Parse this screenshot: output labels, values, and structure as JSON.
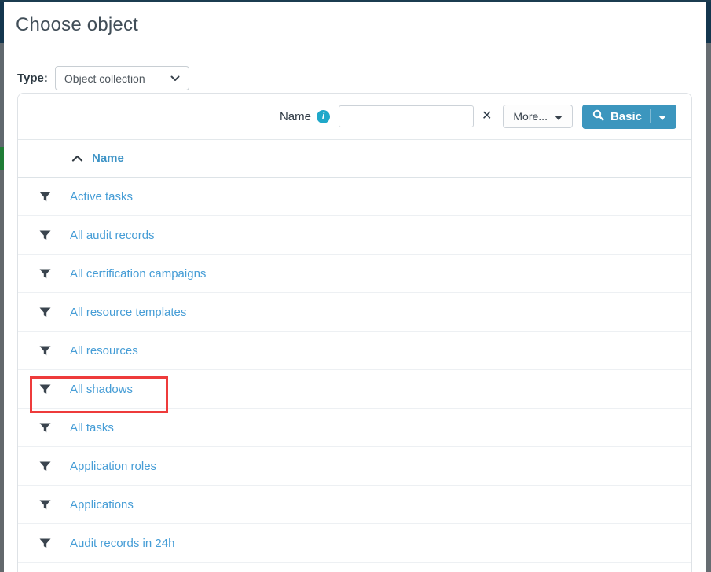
{
  "modal": {
    "title": "Choose object"
  },
  "type_selector": {
    "label": "Type:",
    "value": "Object collection"
  },
  "search": {
    "field_label": "Name",
    "input_value": "",
    "clear_label": "✕",
    "more_label": "More...",
    "basic_label": "Basic"
  },
  "table": {
    "header": "Name",
    "sort_direction": "ascending",
    "rows": [
      {
        "label": "Active tasks",
        "highlighted": false
      },
      {
        "label": "All audit records",
        "highlighted": false
      },
      {
        "label": "All certification campaigns",
        "highlighted": false
      },
      {
        "label": "All resource templates",
        "highlighted": false
      },
      {
        "label": "All resources",
        "highlighted": false
      },
      {
        "label": "All shadows",
        "highlighted": true
      },
      {
        "label": "All tasks",
        "highlighted": false
      },
      {
        "label": "Application roles",
        "highlighted": false
      },
      {
        "label": "Applications",
        "highlighted": false
      },
      {
        "label": "Audit records in 24h",
        "highlighted": false
      }
    ]
  },
  "colors": {
    "accent": "#3c96be",
    "link": "#469dd6",
    "info_icon": "#1fa8c9",
    "highlight_border": "#ee3b3b",
    "filter_icon": "#3a444e"
  }
}
